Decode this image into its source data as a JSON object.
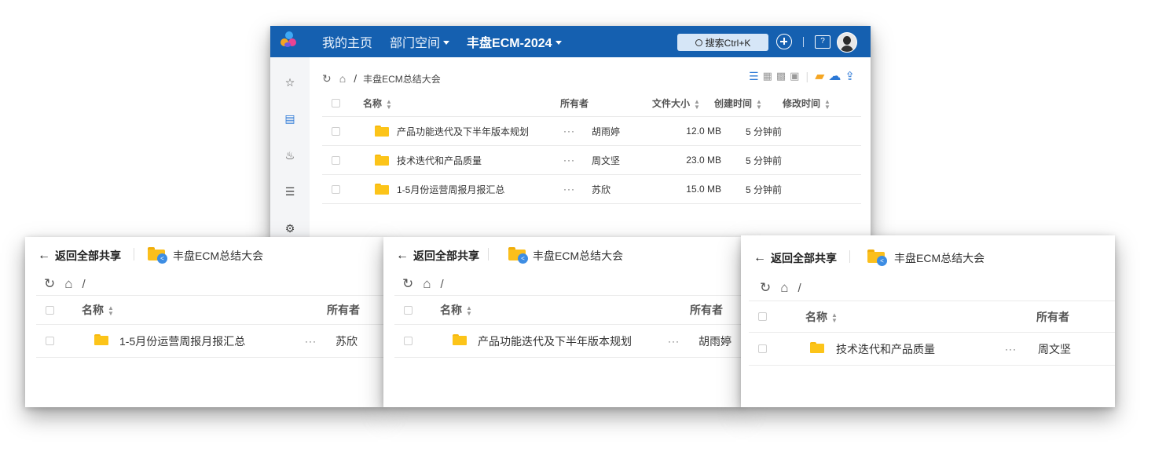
{
  "main": {
    "nav": {
      "home": "我的主页",
      "dept": "部门空间",
      "space": "丰盘ECM-2024",
      "search": "搜索Ctrl+K"
    },
    "breadcrumb": {
      "separator": "/",
      "current": "丰盘ECM总结大会"
    },
    "columns": {
      "name": "名称",
      "owner": "所有者",
      "size": "文件大小",
      "created": "创建时间",
      "modified": "修改时间"
    },
    "rows": [
      {
        "name": "产品功能迭代及下半年版本规划",
        "owner": "胡雨婷",
        "size": "12.0 MB",
        "created": "5 分钟前",
        "menu": "···"
      },
      {
        "name": "技术迭代和产品质量",
        "owner": "周文坚",
        "size": "23.0 MB",
        "created": "5 分钟前",
        "menu": "···"
      },
      {
        "name": "1-5月份运营周报月报汇总",
        "owner": "苏欣",
        "size": "15.0 MB",
        "created": "5 分钟前",
        "menu": "···"
      }
    ]
  },
  "shares": [
    {
      "back": "返回全部共享",
      "title": "丰盘ECM总结大会",
      "slash": "/",
      "col_name": "名称",
      "col_owner": "所有者",
      "row_name": "1-5月份运营周报月报汇总",
      "row_owner": "苏欣",
      "menu": "···"
    },
    {
      "back": "返回全部共享",
      "title": "丰盘ECM总结大会",
      "slash": "/",
      "col_name": "名称",
      "col_owner": "所有者",
      "row_name": "产品功能迭代及下半年版本规划",
      "row_owner": "胡雨婷",
      "menu": "···"
    },
    {
      "back": "返回全部共享",
      "title": "丰盘ECM总结大会",
      "slash": "/",
      "col_name": "名称",
      "col_owner": "所有者",
      "row_name": "技术迭代和产品质量",
      "row_owner": "周文坚",
      "menu": "···"
    }
  ],
  "colors": {
    "topbar": "#1560b0",
    "accent": "#2b78d6",
    "folder": "#fcc419"
  }
}
